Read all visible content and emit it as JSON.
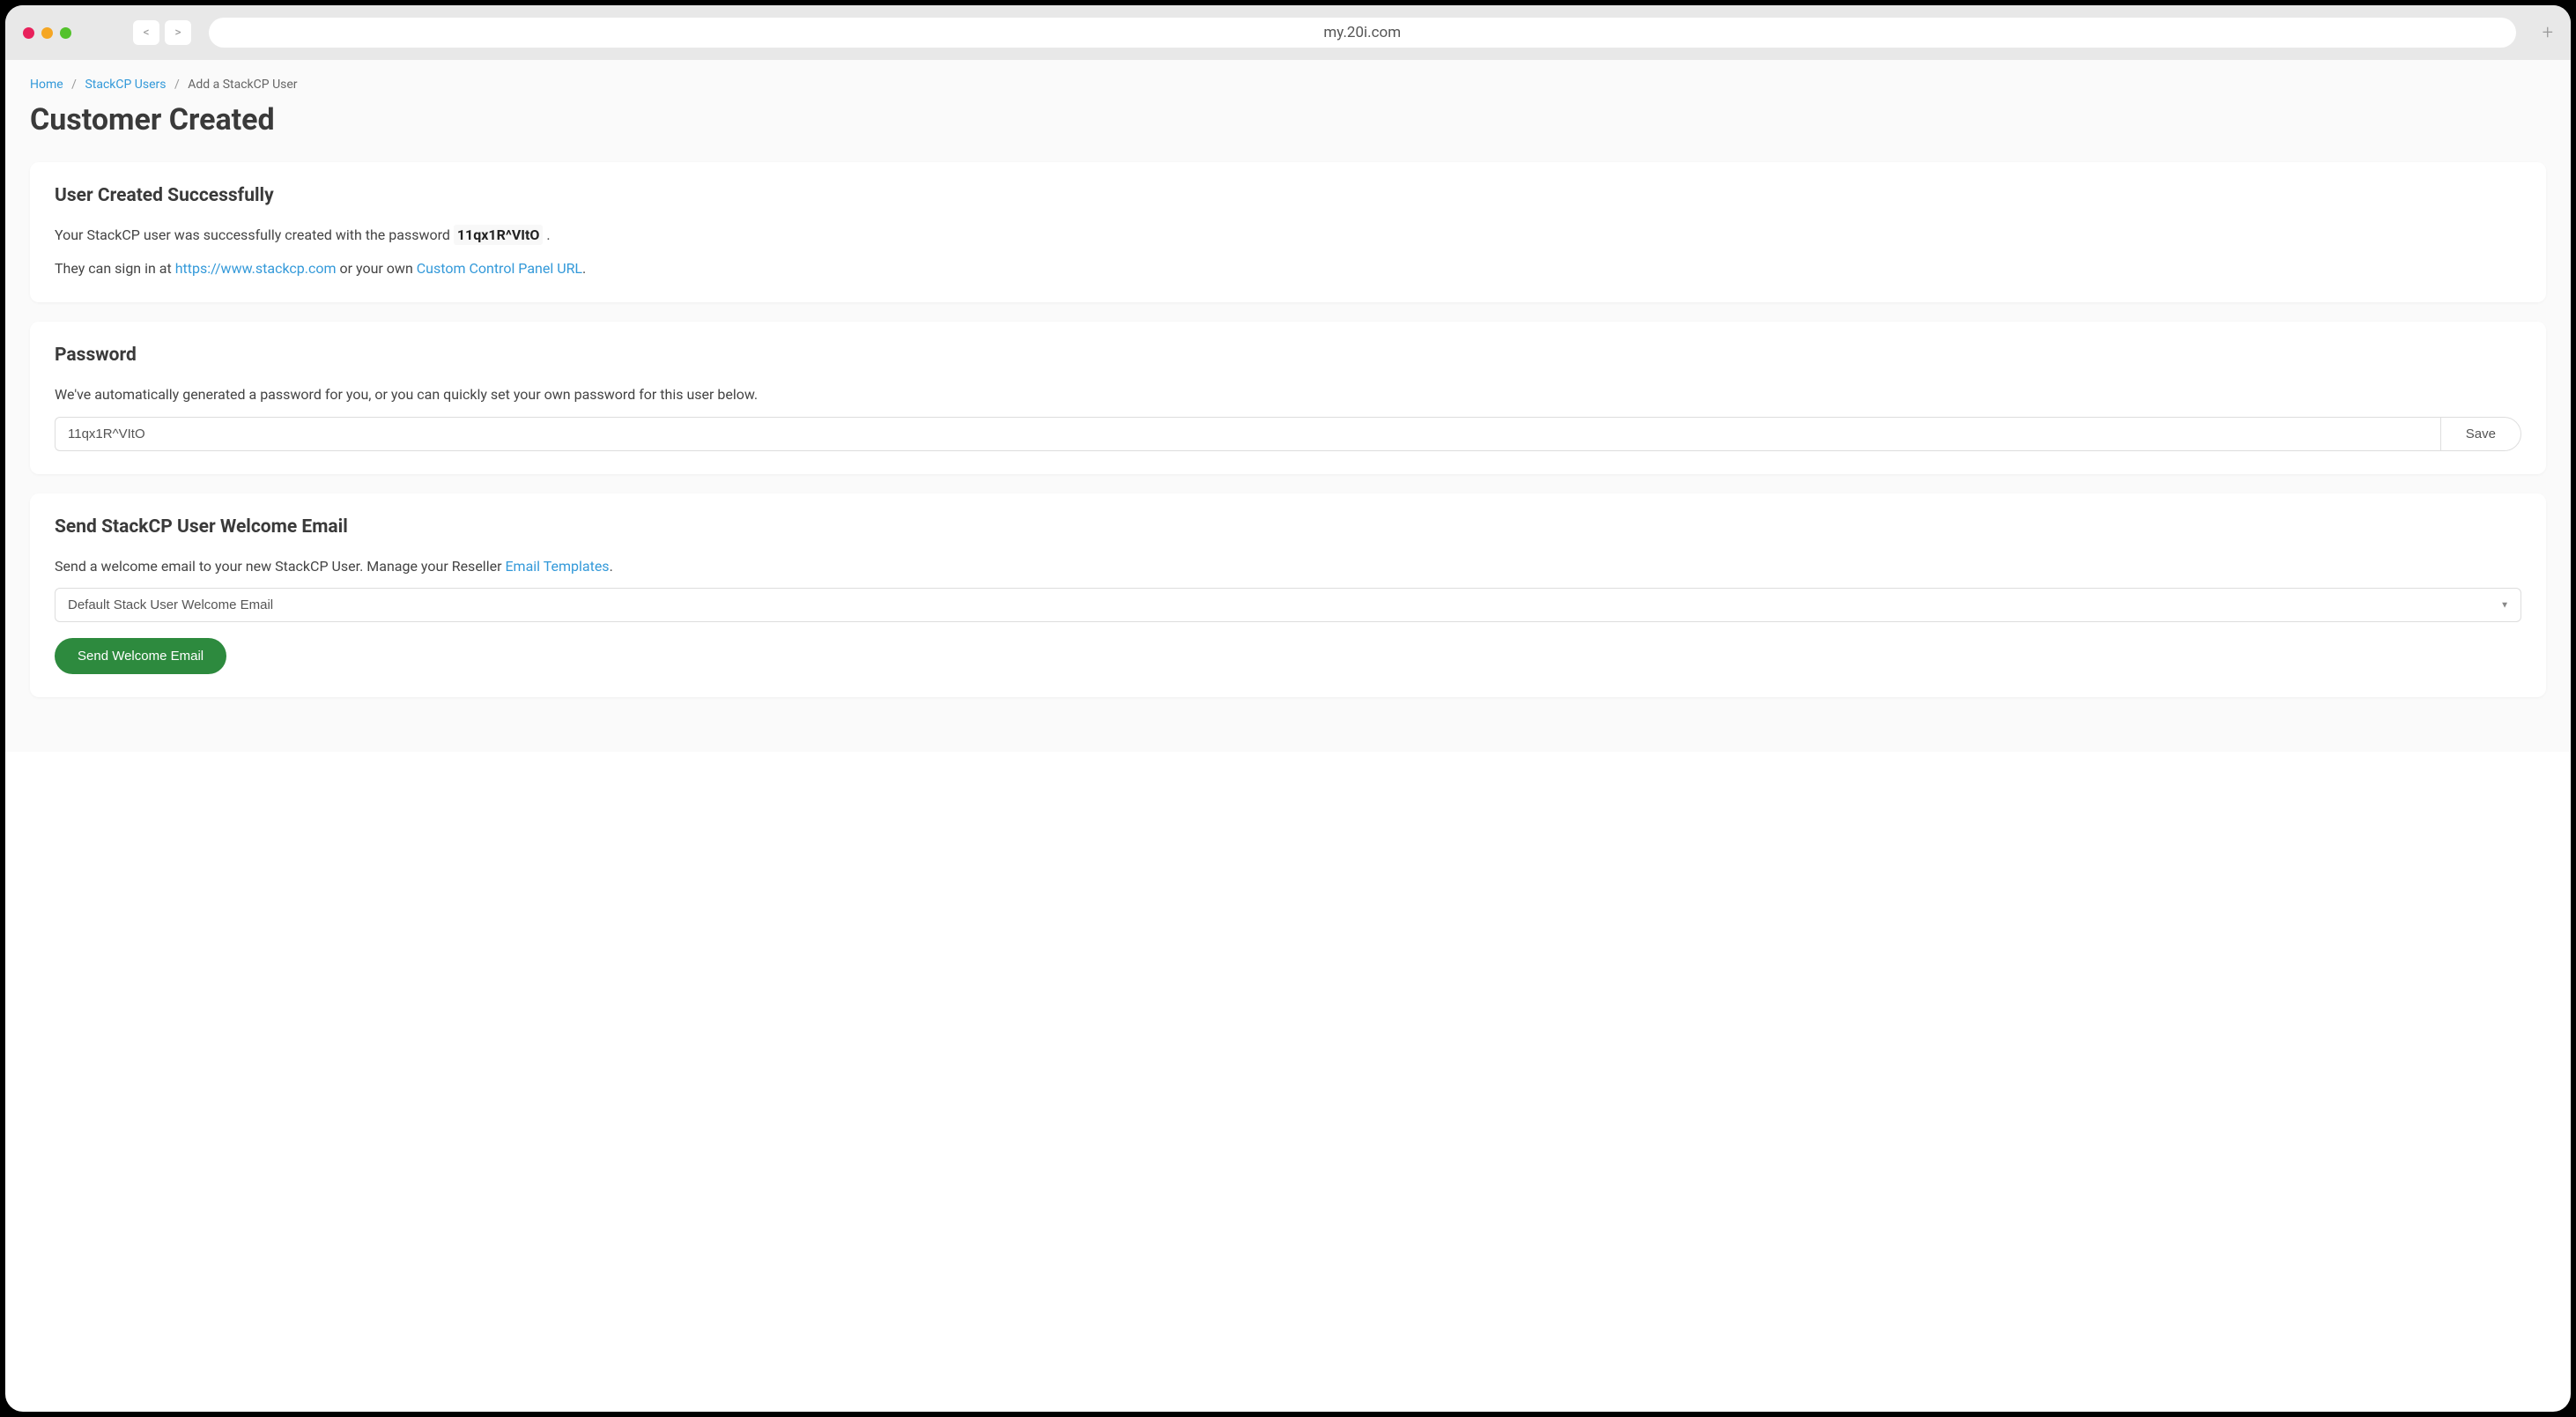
{
  "browser": {
    "url": "my.20i.com",
    "nav_back": "<",
    "nav_forward": ">",
    "new_tab": "+"
  },
  "breadcrumb": {
    "home": "Home",
    "stackcp_users": "StackCP Users",
    "current": "Add a StackCP User"
  },
  "page_title": "Customer Created",
  "success_card": {
    "title": "User Created Successfully",
    "text_prefix": "Your StackCP user was successfully created with the password ",
    "password": "11qx1R^VItO",
    "text_suffix": ".",
    "signin_prefix": "They can sign in at ",
    "signin_link": "https://www.stackcp.com",
    "signin_mid": " or your own ",
    "custom_panel_link": "Custom Control Panel URL",
    "signin_suffix": "."
  },
  "password_card": {
    "title": "Password",
    "description": "We've automatically generated a password for you, or you can quickly set your own password for this user below.",
    "input_value": "11qx1R^VItO",
    "save_label": "Save"
  },
  "welcome_card": {
    "title": "Send StackCP User Welcome Email",
    "desc_prefix": "Send a welcome email to your new StackCP User. Manage your Reseller ",
    "templates_link": "Email Templates",
    "desc_suffix": ".",
    "selected_template": "Default Stack User Welcome Email",
    "send_button": "Send Welcome Email"
  }
}
